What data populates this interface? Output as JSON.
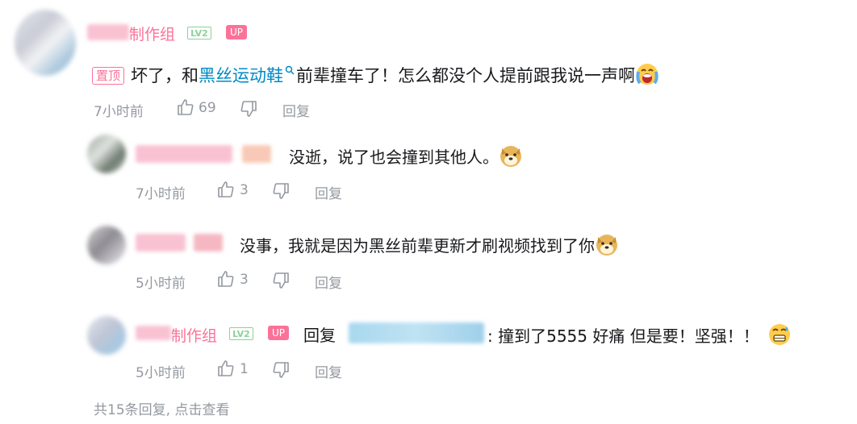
{
  "main_comment": {
    "user_suffix": "制作组",
    "level_badge": "LV2",
    "up_badge": "UP",
    "pin_label": "置顶",
    "text_before": "坏了，和",
    "link_text": "黑丝运动鞋",
    "text_after": "前辈撞车了！怎么都没个人提前跟我说一声啊",
    "emoji_icon": "crying-face-icon",
    "time": "7小时前",
    "likes": "69",
    "reply_label": "回复"
  },
  "replies": [
    {
      "text": "没逝，说了也会撞到其他人。",
      "emoji_icon": "doge-icon",
      "time": "7小时前",
      "likes": "3",
      "reply_label": "回复"
    },
    {
      "text": "没事，我就是因为黑丝前辈更新才刷视频找到了你",
      "emoji_icon": "doge-icon",
      "time": "5小时前",
      "likes": "3",
      "reply_label": "回复"
    },
    {
      "user_suffix": "制作组",
      "level_badge": "LV2",
      "up_badge": "UP",
      "reply_prefix": "回复",
      "text": ": 撞到了5555 好痛 但是要！坚强！！",
      "emoji_icon": "sweating-face-icon",
      "time": "5小时前",
      "likes": "1",
      "reply_label": "回复"
    }
  ],
  "view_more": "共15条回复, 点击查看",
  "colors": {
    "pink": "#fb7299",
    "link": "#008ac5",
    "meta": "#9499a0",
    "level": "#8bd29b"
  }
}
